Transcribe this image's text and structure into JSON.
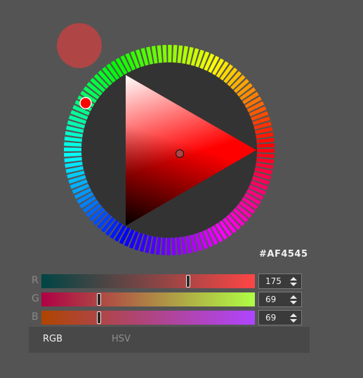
{
  "color": {
    "hex": "#AF4545",
    "hue_color": "#ff0000",
    "preview_color": "#af4545"
  },
  "channels": [
    {
      "letter": "R",
      "value": "175",
      "level": 0.686,
      "gradient_from": "#004545",
      "gradient_to": "#ff4545"
    },
    {
      "letter": "G",
      "value": "69",
      "level": 0.271,
      "gradient_from": "#af0045",
      "gradient_to": "#afff45"
    },
    {
      "letter": "B",
      "value": "69",
      "level": 0.271,
      "gradient_from": "#af4500",
      "gradient_to": "#af45ff"
    }
  ],
  "tabs": [
    {
      "label": "RGB",
      "selected": true
    },
    {
      "label": "HSV",
      "selected": false
    }
  ]
}
